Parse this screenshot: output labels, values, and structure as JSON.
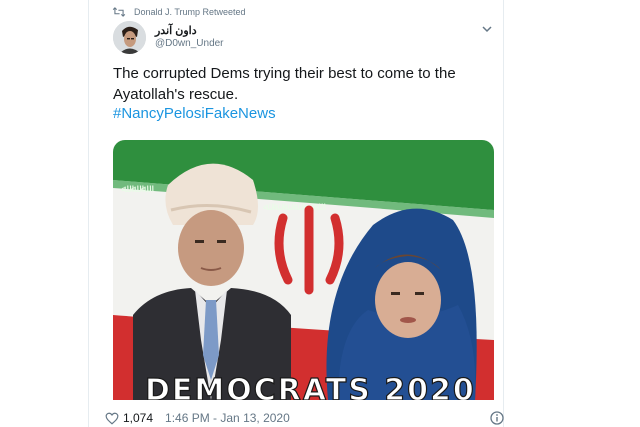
{
  "retweet": {
    "text": "Donald J. Trump Retweeted",
    "icon": "retweet-icon"
  },
  "author": {
    "display_name": "داون آندر",
    "handle": "@D0wn_Under"
  },
  "tweet": {
    "text": "The corrupted Dems trying their best to come to the Ayatollah's rescue.",
    "hashtag": "#NancyPelosiFakeNews"
  },
  "media": {
    "caption": "DEMOCRATS 2020",
    "flag_colors": {
      "green": "#2f8f3e",
      "white": "#f2f2ef",
      "red": "#d22f2f"
    }
  },
  "footer": {
    "likes": "1,074",
    "timestamp": "1:46 PM - Jan 13, 2020",
    "icons": [
      "heart-icon",
      "info-icon"
    ]
  },
  "colors": {
    "link": "#1b95e0",
    "muted": "#657786",
    "text": "#14171a"
  }
}
